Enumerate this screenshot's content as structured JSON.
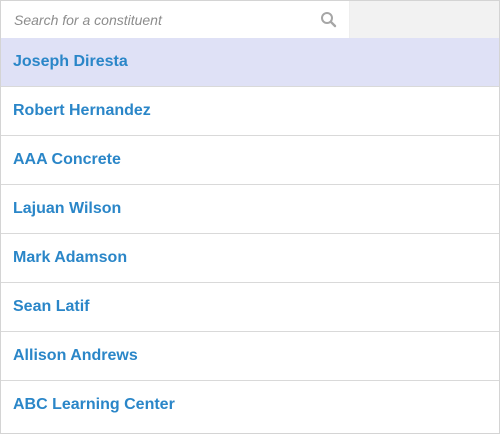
{
  "search": {
    "placeholder": "Search for a constituent",
    "value": "",
    "icon": "search-icon"
  },
  "colors": {
    "link": "#2a86c8",
    "selected_bg": "#dfe1f6",
    "divider": "#d9d9d9"
  },
  "constituents": [
    {
      "name": "Joseph Diresta",
      "selected": true
    },
    {
      "name": "Robert Hernandez",
      "selected": false
    },
    {
      "name": "AAA Concrete",
      "selected": false
    },
    {
      "name": "Lajuan Wilson",
      "selected": false
    },
    {
      "name": "Mark Adamson",
      "selected": false
    },
    {
      "name": "Sean Latif",
      "selected": false
    },
    {
      "name": "Allison Andrews",
      "selected": false
    },
    {
      "name": "ABC Learning Center",
      "selected": false
    }
  ]
}
